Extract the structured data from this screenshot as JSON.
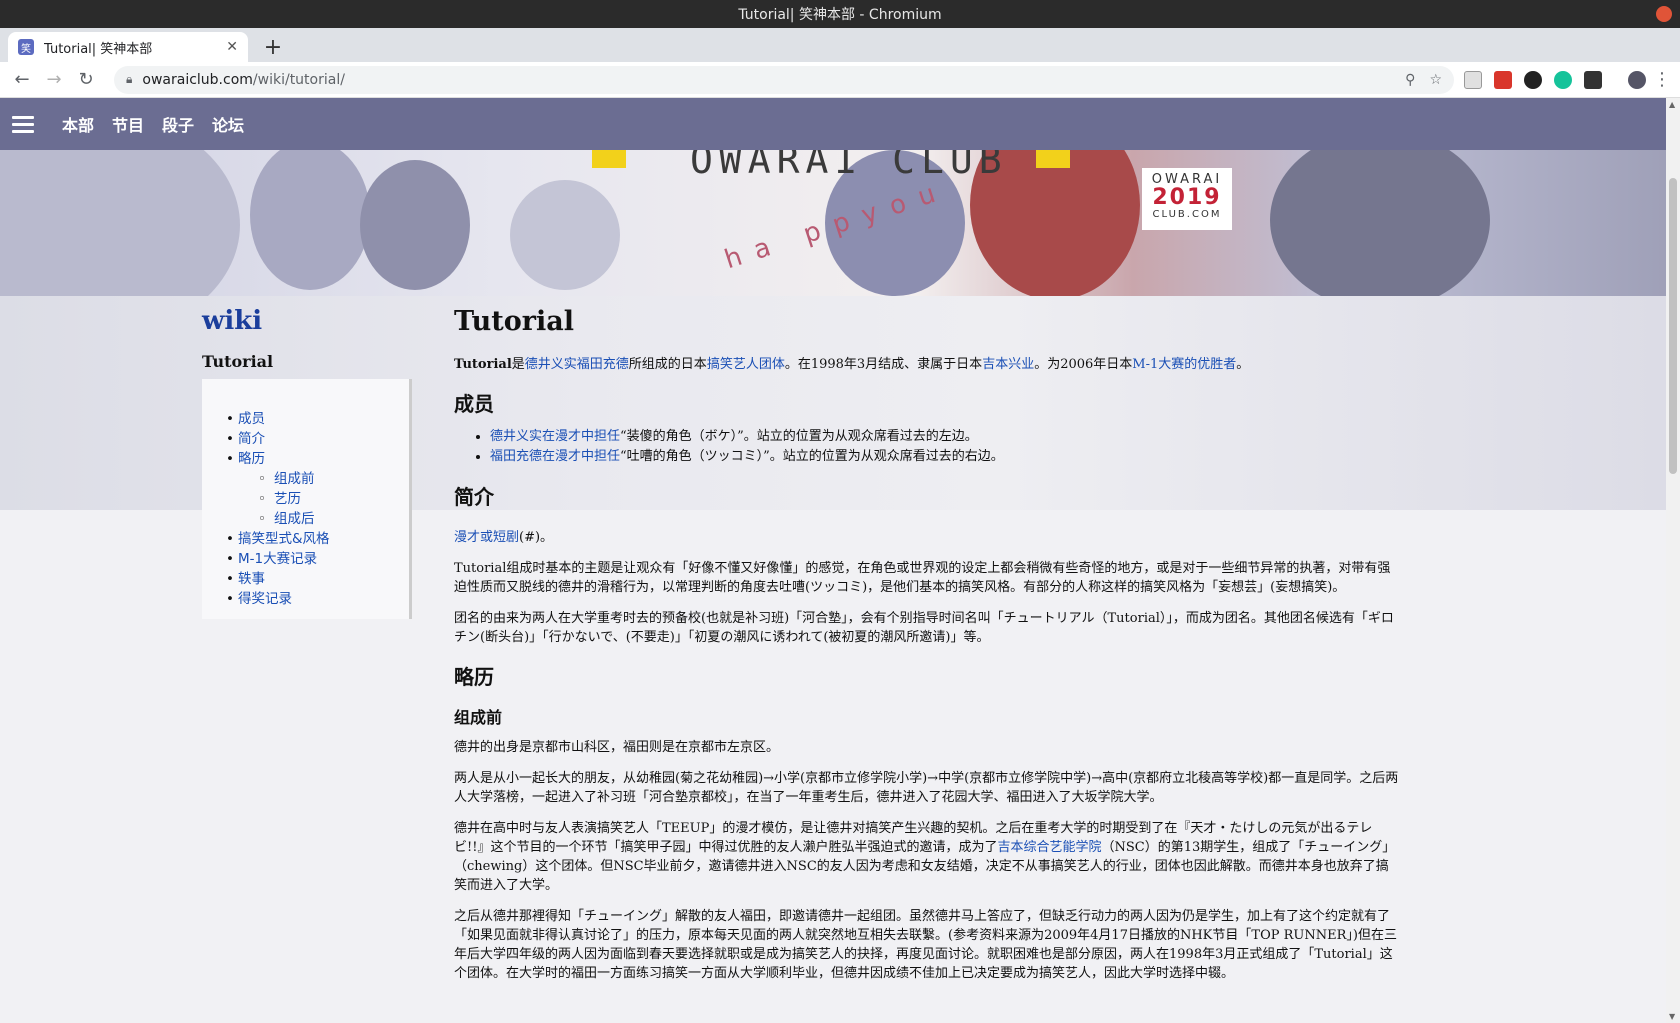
{
  "window": {
    "title": "Tutorial| 笑神本部 - Chromium"
  },
  "tab": {
    "title": "Tutorial| 笑神本部"
  },
  "address": {
    "host": "owaraiclub.com",
    "path": "/wiki/tutorial/"
  },
  "sitenav": {
    "items": [
      "本部",
      "节目",
      "段子",
      "论坛"
    ]
  },
  "banner": {
    "brand": "OWARAI CLUB",
    "happy": "ha ppyou",
    "badge_line1": "OWARAI",
    "badge_year": "2019",
    "badge_line3": "CLUB.COM"
  },
  "sidebar": {
    "wiki": "wiki",
    "page": "Tutorial",
    "toc": [
      {
        "label": "成员",
        "sub": false
      },
      {
        "label": "简介",
        "sub": false
      },
      {
        "label": "略历",
        "sub": false
      },
      {
        "label": "组成前",
        "sub": true
      },
      {
        "label": "艺历",
        "sub": true
      },
      {
        "label": "组成后",
        "sub": true
      },
      {
        "label": "搞笑型式&风格",
        "sub": false
      },
      {
        "label": "M-1大赛记录",
        "sub": false
      },
      {
        "label": "轶事",
        "sub": false
      },
      {
        "label": "得奖记录",
        "sub": false
      }
    ]
  },
  "article": {
    "title": "Tutorial",
    "intro": {
      "t1": "Tutorial",
      "t2": "是",
      "l1": "德井义实福田充德",
      "t3": "所组成的日本",
      "l2": "搞笑艺人团体",
      "t4": "。在1998年3月结成、隶属于日本",
      "l3": "吉本兴业",
      "t5": "。为2006年日本",
      "l4": "M-1大赛的优胜者",
      "t6": "。"
    },
    "members_heading": "成员",
    "members": [
      {
        "link": "德井义实在漫才中担任",
        "text": "“装傻的角色（ボケ）”。站立的位置为从观众席看过去的左边。"
      },
      {
        "link": "福田充德在漫才中担任",
        "text": "“吐嘈的角色（ツッコミ）”。站立的位置为从观众席看过去的右边。"
      }
    ],
    "intro_heading": "简介",
    "intro_p1_link": "漫才或短剧",
    "intro_p1_text": "(#)。",
    "intro_p2": "Tutorial组成时基本的主题是让观众有「好像不懂又好像懂」的感觉，在角色或世界观的设定上都会稍微有些奇怪的地方，或是对于一些细节异常的执著，对带有强迫性质而又脱线的德井的滑稽行为，以常理判断的角度去吐嘈(ツッコミ)，是他们基本的搞笑风格。有部分的人称这样的搞笑风格为「妄想芸」(妄想搞笑)。",
    "intro_p3": "团名的由来为两人在大学重考时去的预备校(也就是补习班)「河合塾」，会有个别指导时间名叫「チュートリアル（Tutorial）」，而成为团名。其他团名候选有「ギロチン(断头台)」「行かないで、(不要走)」「初夏の潮风に诱われて(被初夏的潮风所邀请)」等。",
    "history_heading": "略历",
    "before_heading": "组成前",
    "b_p1": "德井的出身是京都市山科区，福田则是在京都市左京区。",
    "b_p2": "两人是从小一起长大的朋友，从幼稚园(菊之花幼稚园)→小学(京都市立修学院小学)→中学(京都市立修学院中学)→高中(京都府立北稜高等学校)都一直是同学。之后两人大学落榜，一起进入了补习班「河合塾京都校」，在当了一年重考生后，德井进入了花园大学、福田进入了大坂学院大学。",
    "b_p3_a": "德井在高中时与友人表演搞笑艺人「TEEUP」的漫才模仿，是让德井对搞笑产生兴趣的契机。之后在重考大学的时期受到了在『天才・たけしの元気が出るテレビ!!』这个节目的一个环节「搞笑甲子园」中得过优胜的友人濑户胜弘半强迫式的邀请，成为了",
    "b_p3_link": "吉本综合艺能学院",
    "b_p3_b": "（NSC）的第13期学生，组成了「チューイング」（chewing）这个团体。但NSC毕业前夕，邀请德井进入NSC的友人因为考虑和女友结婚，决定不从事搞笑艺人的行业，团体也因此解散。而德井本身也放弃了搞笑而进入了大学。",
    "b_p4": "之后从德井那裡得知「チューイング」解散的友人福田，即邀请德井一起组团。虽然德井马上答应了，但缺乏行动力的两人因为仍是学生，加上有了这个约定就有了「如果见面就非得认真讨论了」的压力，原本每天见面的两人就突然地互相失去联繫。(参考资料来源为2009年4月17日播放的NHK节目「TOP RUNNER」)但在三年后大学四年级的两人因为面临到春天要选择就职或是成为搞笑艺人的抉择，再度见面讨论。就职困难也是部分原因，两人在1998年3月正式组成了「Tutorial」这个团体。在大学时的福田一方面练习搞笑一方面从大学顺利毕业，但德井因成绩不佳加上已决定要成为搞笑艺人，因此大学时选择中辍。"
  },
  "colors": {
    "nav": "#6b6d92",
    "link": "#1a4fb5",
    "wiki": "#1b3e9c"
  }
}
